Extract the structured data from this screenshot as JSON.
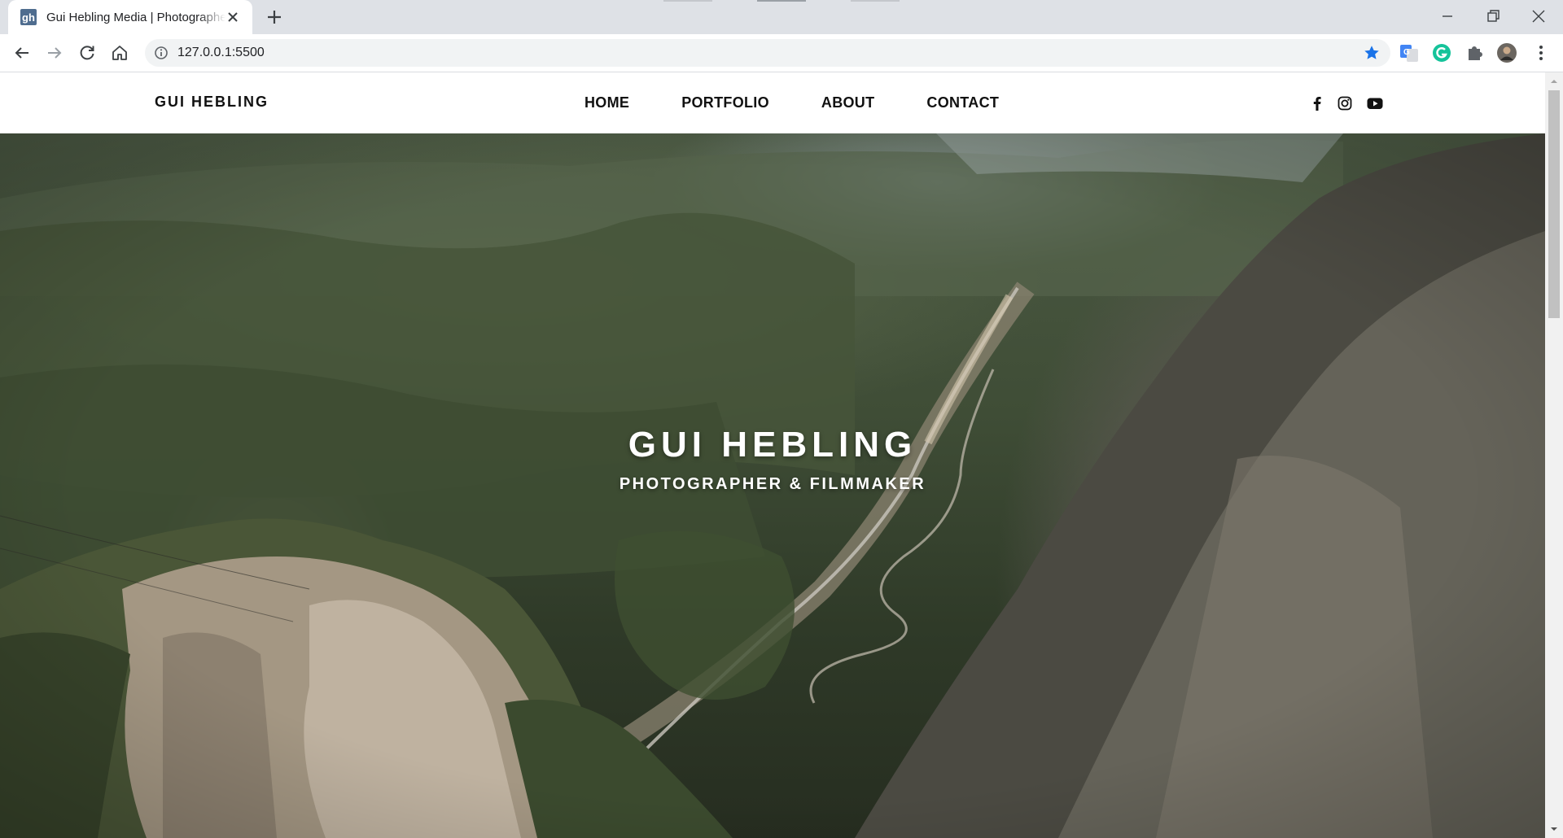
{
  "browser": {
    "tab_title": "Gui Hebling Media | Photographer",
    "favicon_text": "gh",
    "url": "127.0.0.1:5500",
    "accent": "#1a73e8"
  },
  "site": {
    "logo": "GUI HEBLING",
    "nav": [
      "HOME",
      "PORTFOLIO",
      "ABOUT",
      "CONTACT"
    ],
    "social_icons": [
      "facebook-icon",
      "instagram-icon",
      "youtube-icon"
    ]
  },
  "hero": {
    "title": "GUI HEBLING",
    "subtitle": "PHOTOGRAPHER & FILMMAKER",
    "background": "aerial-mountain-valley-photo"
  }
}
